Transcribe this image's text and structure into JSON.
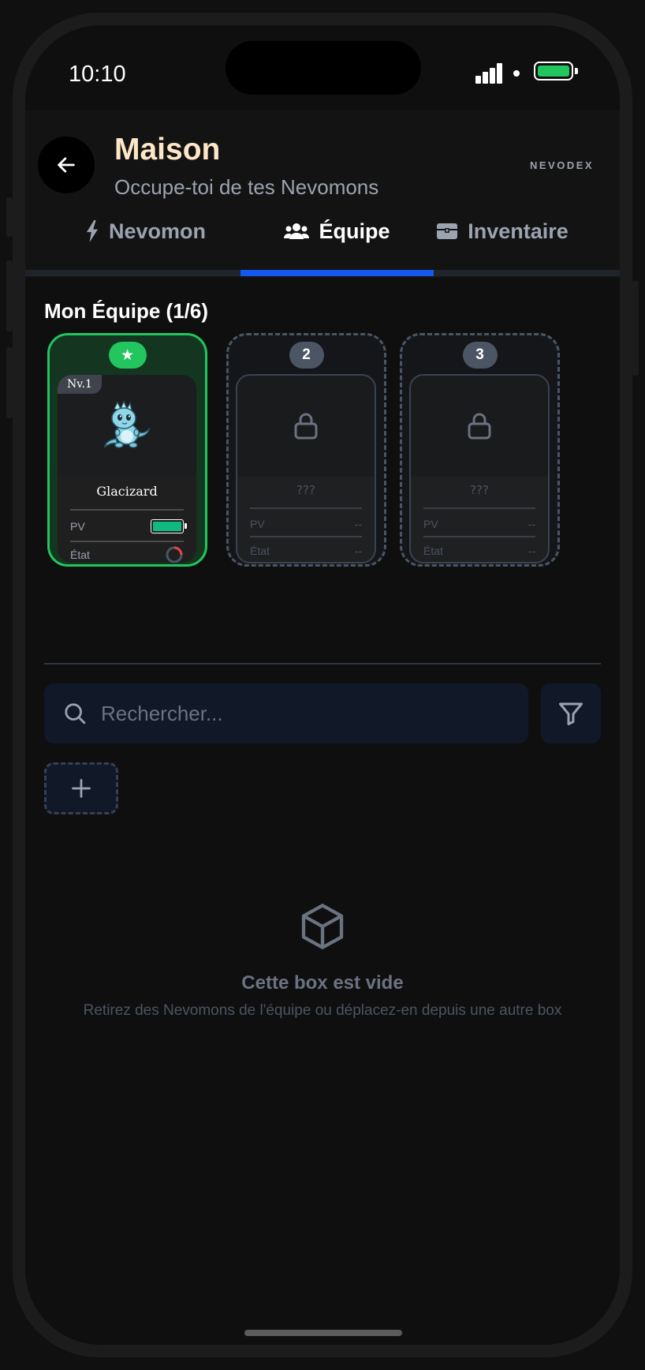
{
  "status_bar": {
    "time": "10:10"
  },
  "header": {
    "title": "Maison",
    "subtitle": "Occupe-toi de tes Nevomons",
    "brand": "NEVODEX"
  },
  "tabs": [
    {
      "label": "Nevomon",
      "icon": "bolt-icon",
      "active": false
    },
    {
      "label": "Équipe",
      "icon": "users-icon",
      "active": true
    },
    {
      "label": "Inventaire",
      "icon": "chest-icon",
      "active": false
    }
  ],
  "team": {
    "title": "Mon Équipe (1/6)",
    "slots": [
      {
        "badge": "★",
        "level": "Nv.1",
        "name": "Glacizard",
        "hp_label": "PV",
        "state_label": "État",
        "hp_fraction": 1.0,
        "filled": true
      },
      {
        "badge": "2",
        "name": "???",
        "hp_label": "PV",
        "hp_value": "--",
        "state_label": "État",
        "state_value": "--",
        "filled": false
      },
      {
        "badge": "3",
        "name": "???",
        "hp_label": "PV",
        "hp_value": "--",
        "state_label": "État",
        "state_value": "--",
        "filled": false
      }
    ]
  },
  "search": {
    "placeholder": "Rechercher..."
  },
  "box": {
    "empty_title": "Cette box est vide",
    "empty_desc": "Retirez des Nevomons de l'équipe ou déplacez-en depuis une autre box"
  },
  "colors": {
    "accent": "#1558ef",
    "team_active": "#22c55e",
    "hp": "#10b981",
    "title": "#fde7c7"
  }
}
